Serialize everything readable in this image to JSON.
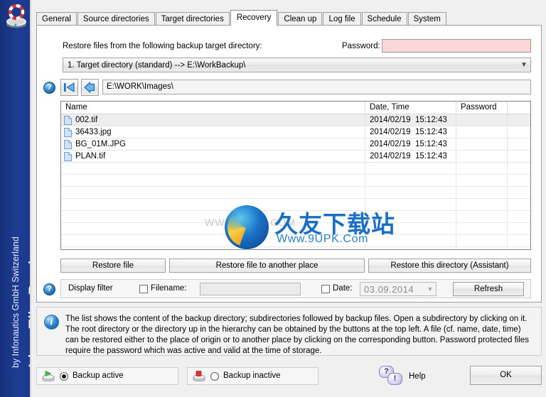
{
  "branding": {
    "title": "Live File Backup",
    "subtitle": "by Infonautics GmbH Switzerland",
    "logo_icon": "backup-drive-lifering-logo",
    "bg_color": "#1b3a8c"
  },
  "tabs": [
    {
      "label": "General",
      "active": false
    },
    {
      "label": "Source directories",
      "active": false
    },
    {
      "label": "Target directories",
      "active": false
    },
    {
      "label": "Recovery",
      "active": true
    },
    {
      "label": "Clean up",
      "active": false
    },
    {
      "label": "Log file",
      "active": false
    },
    {
      "label": "Schedule",
      "active": false
    },
    {
      "label": "System",
      "active": false
    }
  ],
  "recovery": {
    "restore_from_label": "Restore files from the following backup target directory:",
    "password_label": "Password:",
    "password_value": "",
    "password_field_color": "#fbd8d8",
    "target_directory": "1. Target directory (standard) --> E:\\WorkBackup\\",
    "nav": {
      "help_icon": "question-circle-icon",
      "root_button_icon": "back-to-root-arrow-icon",
      "up_button_icon": "back-arrow-icon",
      "path": "E:\\WORK\\Images\\"
    },
    "list": {
      "columns": [
        "Name",
        "Date, Time",
        "Password"
      ],
      "rows": [
        {
          "icon": "file-icon",
          "name": "002.tif",
          "date": "2014/02/19",
          "time": "15:12:43",
          "password": "",
          "selected": true
        },
        {
          "icon": "file-icon",
          "name": "36433.jpg",
          "date": "2014/02/19",
          "time": "15:12:43",
          "password": "",
          "selected": false
        },
        {
          "icon": "file-icon",
          "name": "BG_01M.JPG",
          "date": "2014/02/19",
          "time": "15:12:43",
          "password": "",
          "selected": false
        },
        {
          "icon": "file-icon",
          "name": "PLAN.tif",
          "date": "2014/02/19",
          "time": "15:12:43",
          "password": "",
          "selected": false
        }
      ]
    },
    "watermark": {
      "chinese": "久友下载站",
      "url": "Www.9UPK.Com",
      "faint": "WWW.9UPK.COM"
    },
    "buttons": {
      "restore_file": "Restore file",
      "restore_another": "Restore file to another place",
      "restore_directory": "Restore this directory (Assistant)"
    },
    "filter": {
      "help_icon": "question-circle-icon",
      "display_filter_label": "Display filter",
      "filename_label": "Filename:",
      "filename_checked": false,
      "filename_value": "",
      "date_label": "Date:",
      "date_checked": false,
      "date_value": "03.09.2014",
      "refresh_label": "Refresh"
    }
  },
  "info": {
    "icon": "info-circle-icon",
    "text": "The list shows the content of the backup directory; subdirectories followed by backup files. Open a subdirectory by clicking on it. The root directory or the directory up in the hierarchy can be obtained by the buttons at the top left. A file (cf. name, date, time)  can be restored either to the place of origin or to another place by clicking on the corresponding button. Password protected files require the password which was active and valid at the time of storage."
  },
  "bottom": {
    "backup_active_label": "Backup active",
    "backup_active_icon": "green-play-drive-icon",
    "backup_active_selected": true,
    "backup_inactive_label": "Backup inactive",
    "backup_inactive_icon": "red-stop-drive-icon",
    "backup_inactive_selected": false,
    "help_label": "Help",
    "help_icon": "question-exclamation-bubbles-icon",
    "ok_label": "OK"
  }
}
